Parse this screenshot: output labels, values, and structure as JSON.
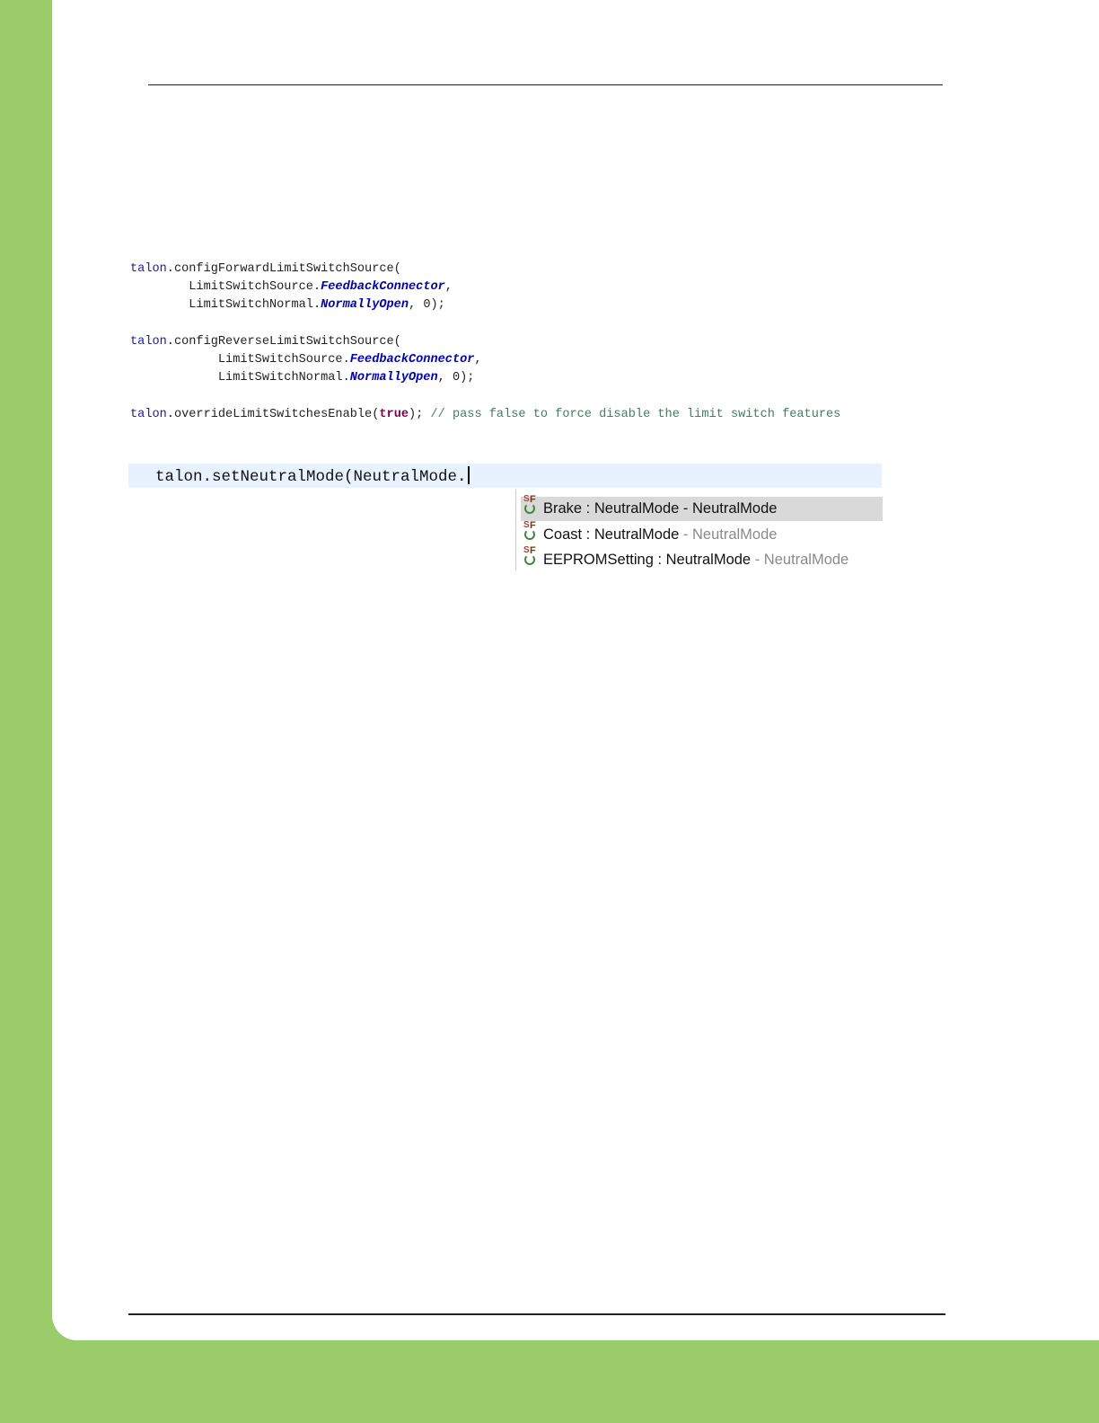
{
  "code_lines": [
    [
      {
        "t": "talon",
        "c": "var"
      },
      {
        "t": ".configForwardLimitSwitchSource(",
        "c": ""
      }
    ],
    [
      {
        "t": "        LimitSwitchSource.",
        "c": ""
      },
      {
        "t": "FeedbackConnector",
        "c": "field"
      },
      {
        "t": ",",
        "c": ""
      }
    ],
    [
      {
        "t": "        LimitSwitchNormal.",
        "c": ""
      },
      {
        "t": "NormallyOpen",
        "c": "field"
      },
      {
        "t": ", 0);",
        "c": ""
      }
    ],
    [],
    [
      {
        "t": "talon",
        "c": "var"
      },
      {
        "t": ".configReverseLimitSwitchSource(",
        "c": ""
      }
    ],
    [
      {
        "t": "            LimitSwitchSource.",
        "c": ""
      },
      {
        "t": "FeedbackConnector",
        "c": "field"
      },
      {
        "t": ",",
        "c": ""
      }
    ],
    [
      {
        "t": "            LimitSwitchNormal.",
        "c": ""
      },
      {
        "t": "NormallyOpen",
        "c": "field"
      },
      {
        "t": ", 0);",
        "c": ""
      }
    ],
    [],
    [
      {
        "t": "talon",
        "c": "var"
      },
      {
        "t": ".overrideLimitSwitchesEnable(",
        "c": ""
      },
      {
        "t": "true",
        "c": "kw"
      },
      {
        "t": "); ",
        "c": ""
      },
      {
        "t": "// pass false to force disable the limit switch features",
        "c": "cmt"
      }
    ]
  ],
  "editor": {
    "typed_text": "talon.setNeutralMode(NeutralMode."
  },
  "autocomplete": {
    "items": [
      {
        "name": "Brake : NeutralMode",
        "type": " - NeutralMode",
        "selected": true,
        "icon": "static-final-field-icon"
      },
      {
        "name": "Coast : NeutralMode",
        "type": " - NeutralMode",
        "selected": false,
        "icon": "static-final-field-icon"
      },
      {
        "name": "EEPROMSetting : NeutralMode",
        "type": " - NeutralMode",
        "selected": false,
        "icon": "static-final-field-icon"
      }
    ]
  },
  "colors": {
    "page_border_green": "#9acd6a",
    "editor_line_highlight": "#e8f2fe",
    "selection_gray": "#d9d9d9"
  }
}
